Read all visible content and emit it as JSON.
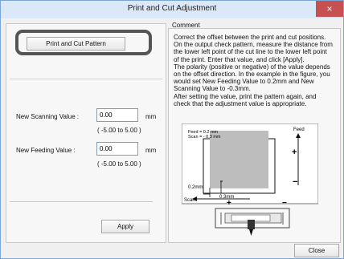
{
  "window": {
    "title": "Print and Cut Adjustment",
    "close_glyph": "×"
  },
  "left": {
    "pattern_button": "Print and Cut Pattern",
    "scan_label": "New Scanning Value :",
    "scan_value": "0.00",
    "scan_unit": "mm",
    "scan_range": "( -5.00  to  5.00 )",
    "feed_label": "New Feeding Value :",
    "feed_value": "0.00",
    "feed_unit": "mm",
    "feed_range": "( -5.00  to  5.00 )",
    "apply": "Apply"
  },
  "right": {
    "comment_label": "Comment",
    "comment_lines": [
      "Correct the offset between the print and cut positions.",
      "On the output check pattern, measure the distance from",
      "the lower left point of the cut line to the lower left point",
      "of the print. Enter that value, and click [Apply].",
      "The polarity (positive or negative) of the value depends",
      "on the offset direction. In the example in the figure, you",
      "would set New Feeding Value to 0.2mm and New",
      "Scanning Value to -0.3mm.",
      "After setting the value, print the pattern again, and",
      "check that the adjustment value is appropriate."
    ],
    "figure": {
      "feed_value": "Feed = 0.2 mm",
      "scan_value": "Scan = - 0.3 mm",
      "feed_axis": "Feed",
      "scan_axis": "Scan",
      "offset_vertical": "0.2mm",
      "offset_horizontal": "0.3mm",
      "plus": "+",
      "minus": "−"
    }
  },
  "footer": {
    "close": "Close"
  }
}
